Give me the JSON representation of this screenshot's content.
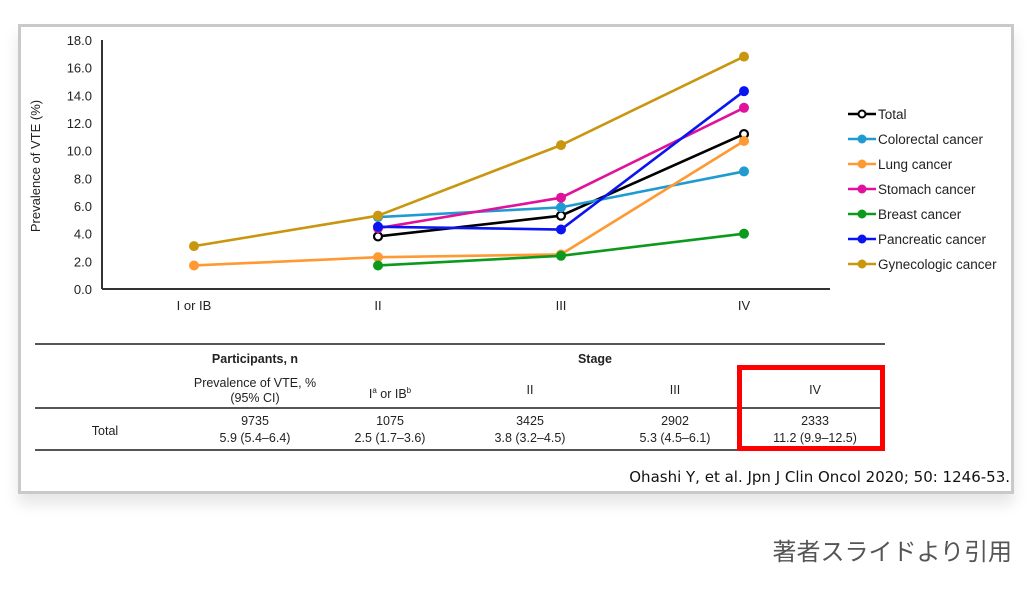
{
  "chart_data": {
    "type": "line",
    "title": "",
    "xlabel": "",
    "ylabel": "Prevalence of VTE (%)",
    "ylim": [
      0,
      18
    ],
    "yticks": [
      "0.0",
      "2.0",
      "4.0",
      "6.0",
      "8.0",
      "10.0",
      "12.0",
      "14.0",
      "16.0",
      "18.0"
    ],
    "categories": [
      "I or IB",
      "II",
      "III",
      "IV"
    ],
    "legend_position": "right",
    "grid": false,
    "series": [
      {
        "name": "Total",
        "color": "#000000",
        "marker": "open-circle",
        "values": [
          null,
          3.8,
          5.3,
          11.2
        ]
      },
      {
        "name": "Colorectal cancer",
        "color": "#1f9bd1",
        "marker": "circle",
        "values": [
          null,
          5.2,
          5.9,
          8.5
        ]
      },
      {
        "name": "Lung cancer",
        "color": "#ff9933",
        "marker": "circle",
        "values": [
          1.7,
          2.3,
          2.5,
          10.7
        ]
      },
      {
        "name": "Stomach cancer",
        "color": "#e0119b",
        "marker": "circle",
        "values": [
          null,
          4.4,
          6.6,
          13.1
        ]
      },
      {
        "name": "Breast cancer",
        "color": "#0b9a1b",
        "marker": "circle",
        "values": [
          null,
          1.7,
          2.4,
          4.0
        ]
      },
      {
        "name": "Pancreatic cancer",
        "color": "#0a14f0",
        "marker": "circle",
        "values": [
          null,
          4.5,
          4.3,
          14.3
        ]
      },
      {
        "name": "Gynecologic cancer",
        "color": "#c8960f",
        "marker": "circle",
        "values": [
          3.1,
          5.3,
          10.4,
          16.8
        ]
      }
    ]
  },
  "table": {
    "col_header_participants": "Participants, n",
    "col_header_prevalence_line1": "Prevalence of VTE, %",
    "col_header_prevalence_line2": "(95% CI)",
    "stage_header": "Stage",
    "stage_I_main": "I",
    "stage_I_sup_a": "a",
    "stage_I_or": " or IB",
    "stage_I_sup_b": "b",
    "stage_columns": [
      "II",
      "III",
      "IV"
    ],
    "row_label": "Total",
    "overall_n": "9735",
    "overall_prev": "5.9 (5.4–6.4)",
    "stage_values": [
      {
        "n": "1075",
        "prev": "2.5 (1.7–3.6)"
      },
      {
        "n": "3425",
        "prev": "3.8 (3.2–4.5)"
      },
      {
        "n": "2902",
        "prev": "5.3 (4.5–6.1)"
      },
      {
        "n": "2333",
        "prev": "11.2 (9.9–12.5)"
      }
    ],
    "highlighted_column": "IV",
    "highlight_color": "#ff0000"
  },
  "citation": "Ohashi Y, et al. Jpn J Clin Oncol 2020; 50: 1246-53.",
  "caption": "著者スライドより引用"
}
